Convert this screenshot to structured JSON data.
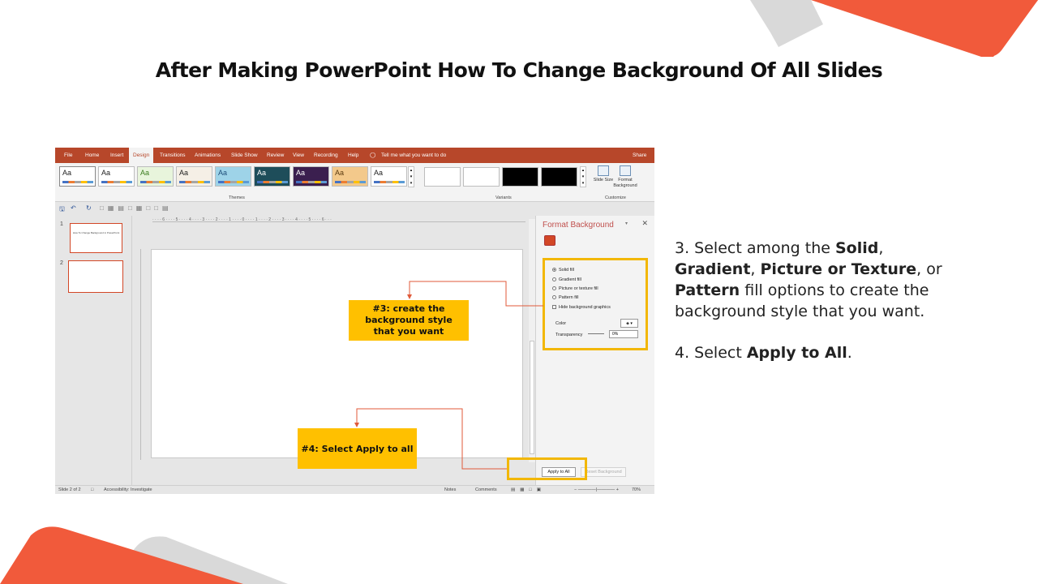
{
  "title": "After Making PowerPoint How To Change Background Of All Slides",
  "ribbon_tabs": [
    "File",
    "Home",
    "Insert",
    "Design",
    "Transitions",
    "Animations",
    "Slide Show",
    "Review",
    "View",
    "Recording",
    "Help"
  ],
  "active_tab": "Design",
  "tell_me": "Tell me what you want to do",
  "share": "Share",
  "themes": {
    "label": "Themes",
    "items": [
      {
        "glyph": "Aa",
        "bg": "#ffffff",
        "fg": "#222222"
      },
      {
        "glyph": "Aa",
        "bg": "#ffffff",
        "fg": "#222222"
      },
      {
        "glyph": "Aa",
        "bg": "#e8f5dc",
        "fg": "#3a7d1e"
      },
      {
        "glyph": "Aa",
        "bg": "#f5efe6",
        "fg": "#222222"
      },
      {
        "glyph": "Aa",
        "bg": "#9ed3e8",
        "fg": "#1f4e79"
      },
      {
        "glyph": "Aa",
        "bg": "#1e4d5a",
        "fg": "#ffffff"
      },
      {
        "glyph": "Aa",
        "bg": "#3b1f4f",
        "fg": "#ffffff"
      },
      {
        "glyph": "Aa",
        "bg": "#f3c98b",
        "fg": "#5a3b10"
      },
      {
        "glyph": "Aa",
        "bg": "#ffffff",
        "fg": "#222222"
      }
    ]
  },
  "variants": {
    "label": "Variants",
    "colors": [
      "#ffffff",
      "#ffffff",
      "#000000",
      "#000000"
    ]
  },
  "customize": {
    "label": "Customize",
    "slide_size": "Slide Size",
    "format_background": "Format Background"
  },
  "thumbs": {
    "items": [
      {
        "num": "1",
        "text": "How To Change Background in PowerPoint"
      },
      {
        "num": "2",
        "text": ""
      }
    ]
  },
  "format_panel": {
    "title": "Format Background",
    "options": [
      "Solid fill",
      "Gradient fill",
      "Picture or texture fill",
      "Pattern fill"
    ],
    "hide_bg": "Hide background graphics",
    "color_label": "Color",
    "transparency_label": "Transparency",
    "transparency_value": "0%",
    "apply_all": "Apply to All",
    "reset": "Reset Background"
  },
  "status": {
    "slide": "Slide 2 of 2",
    "accessibility": "Accessibility: Investigate",
    "notes": "Notes",
    "comments": "Comments",
    "zoom": "70%"
  },
  "callouts": {
    "step3": "#3: create the background style that you want",
    "step4": "#4: Select Apply to all"
  },
  "instructions": {
    "step3_prefix": "3. Select among the ",
    "solid": "Solid",
    "comma1": ", ",
    "gradient": "Gradient",
    "comma2": ", ",
    "picture": "Picture or Texture",
    "or": ", or ",
    "pattern": "Pattern",
    "step3_suffix": " fill options to create the background style that you want.",
    "step4_prefix": "4. Select ",
    "apply": "Apply to All",
    "step4_suffix": "."
  },
  "colors": {
    "accent": "#f15a3b",
    "ribbon": "#b7472a",
    "highlight": "#f2b705",
    "callout": "#ffc000"
  }
}
